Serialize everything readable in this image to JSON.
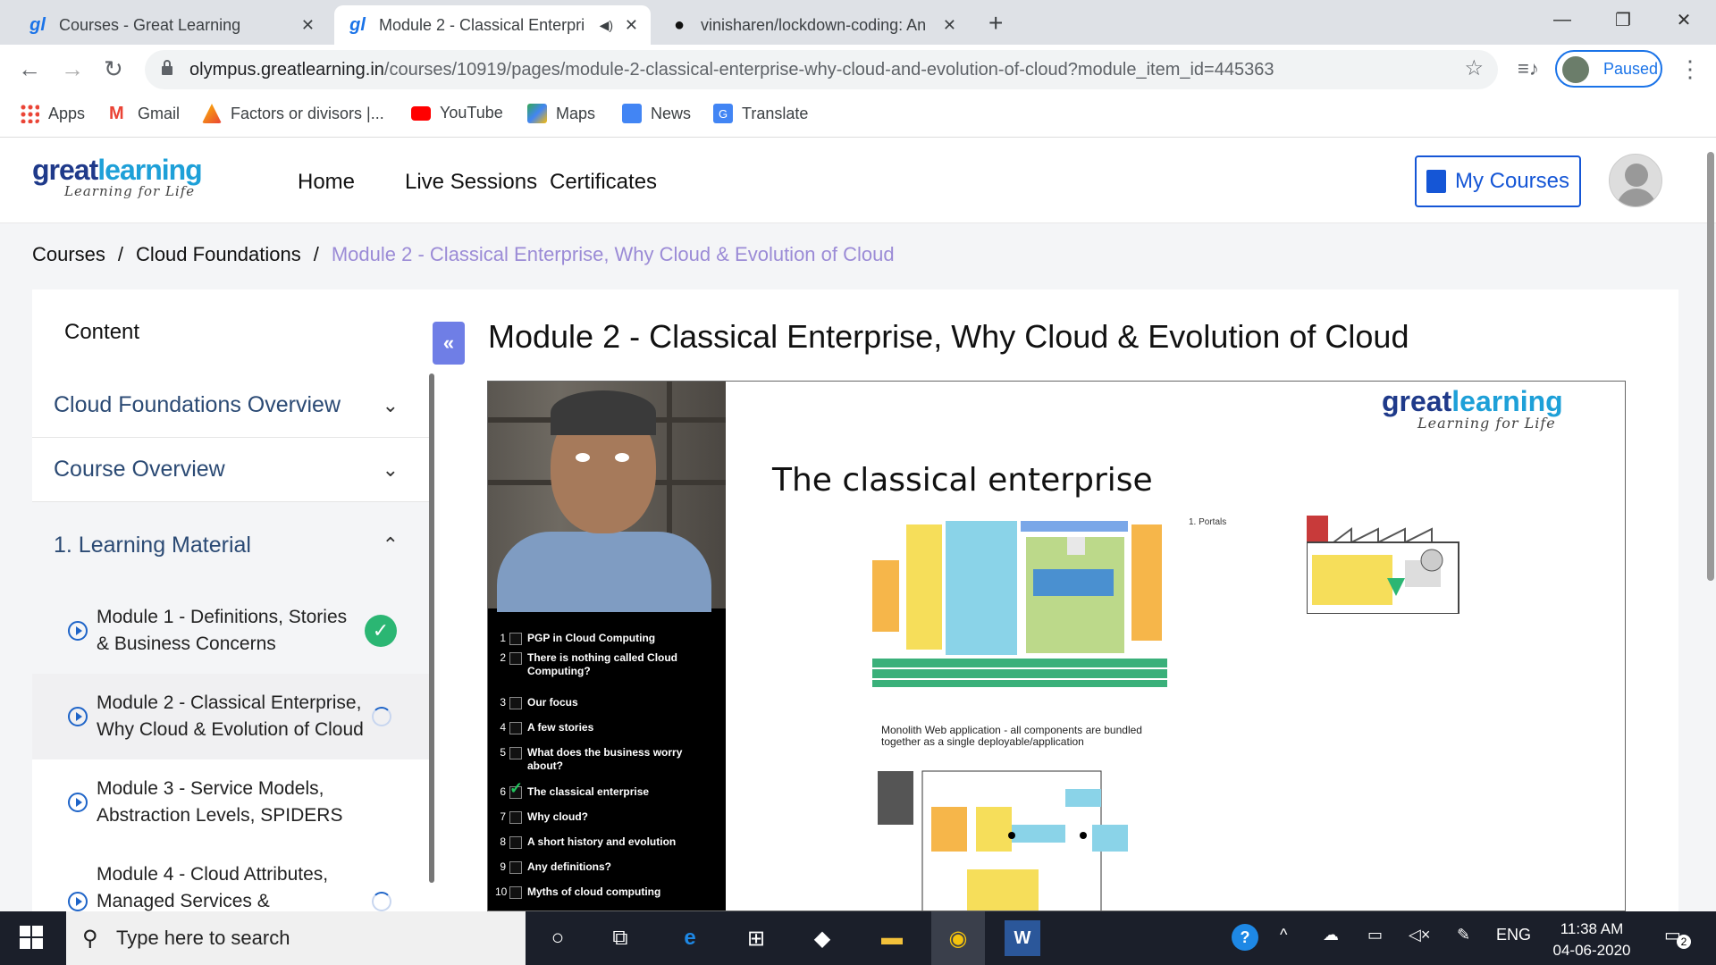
{
  "browser": {
    "tabs": [
      {
        "title": "Courses - Great Learning",
        "active": false
      },
      {
        "title": "Module 2 - Classical Enterpri",
        "active": true
      },
      {
        "title": "vinisharen/lockdown-coding: An",
        "active": false
      }
    ],
    "url_host": "olympus.greatlearning.in",
    "url_path": "/courses/10919/pages/module-2-classical-enterprise-why-cloud-and-evolution-of-cloud?module_item_id=445363",
    "profile_label": "Paused",
    "bookmarks": [
      "Apps",
      "Gmail",
      "Factors or divisors |...",
      "YouTube",
      "Maps",
      "News",
      "Translate"
    ]
  },
  "site": {
    "logo_main_a": "great",
    "logo_main_b": "learning",
    "logo_tagline": "Learning for Life",
    "nav": [
      "Home",
      "Live Sessions",
      "Certificates"
    ],
    "my_courses": "My Courses"
  },
  "breadcrumb": {
    "items": [
      "Courses",
      "Cloud Foundations"
    ],
    "current": "Module 2 - Classical Enterprise, Why Cloud & Evolution of Cloud",
    "separator": "/"
  },
  "sidebar": {
    "title": "Content",
    "sections": [
      {
        "label": "Cloud Foundations Overview",
        "expanded": false
      },
      {
        "label": "Course Overview",
        "expanded": false
      },
      {
        "label": "1. Learning Material",
        "expanded": true
      }
    ],
    "items": [
      {
        "line1": "Module 1 - Definitions, Stories",
        "line2": "& Business Concerns",
        "status": "done"
      },
      {
        "line1": "Module 2 - Classical Enterprise,",
        "line2": "Why Cloud & Evolution of Cloud",
        "status": "in-progress"
      },
      {
        "line1": "Module 3 - Service Models,",
        "line2": "Abstraction Levels, SPIDERS",
        "status": "none"
      },
      {
        "line1": "Module 4 - Cloud Attributes,",
        "line2": "Managed Services &",
        "status": "in-progress"
      }
    ]
  },
  "main": {
    "title": "Module 2 - Classical Enterprise, Why Cloud & Evolution of Cloud"
  },
  "video": {
    "slide_title": "The classical enterprise",
    "portals": "1.    Portals",
    "caption": "Monolith Web application - all components are bundled together as a single deployable/application",
    "logo_a": "great",
    "logo_b": "learning",
    "logo_tagline": "Learning for Life",
    "toc": [
      {
        "n": "1",
        "t": "PGP in Cloud Computing",
        "checked": false
      },
      {
        "n": "2",
        "t": "There is nothing called Cloud Computing?",
        "checked": false
      },
      {
        "n": "3",
        "t": "Our focus",
        "checked": false
      },
      {
        "n": "4",
        "t": "A few stories",
        "checked": false
      },
      {
        "n": "5",
        "t": "What does the business worry about?",
        "checked": false
      },
      {
        "n": "6",
        "t": "The classical enterprise",
        "checked": true
      },
      {
        "n": "7",
        "t": "Why cloud?",
        "checked": false
      },
      {
        "n": "8",
        "t": "A short history and evolution",
        "checked": false
      },
      {
        "n": "9",
        "t": "Any definitions?",
        "checked": false
      },
      {
        "n": "10",
        "t": "Myths of cloud computing",
        "checked": false
      }
    ]
  },
  "taskbar": {
    "search_placeholder": "Type here to search",
    "lang": "ENG",
    "time": "11:38 AM",
    "date": "04-06-2020",
    "notif_count": "2"
  }
}
